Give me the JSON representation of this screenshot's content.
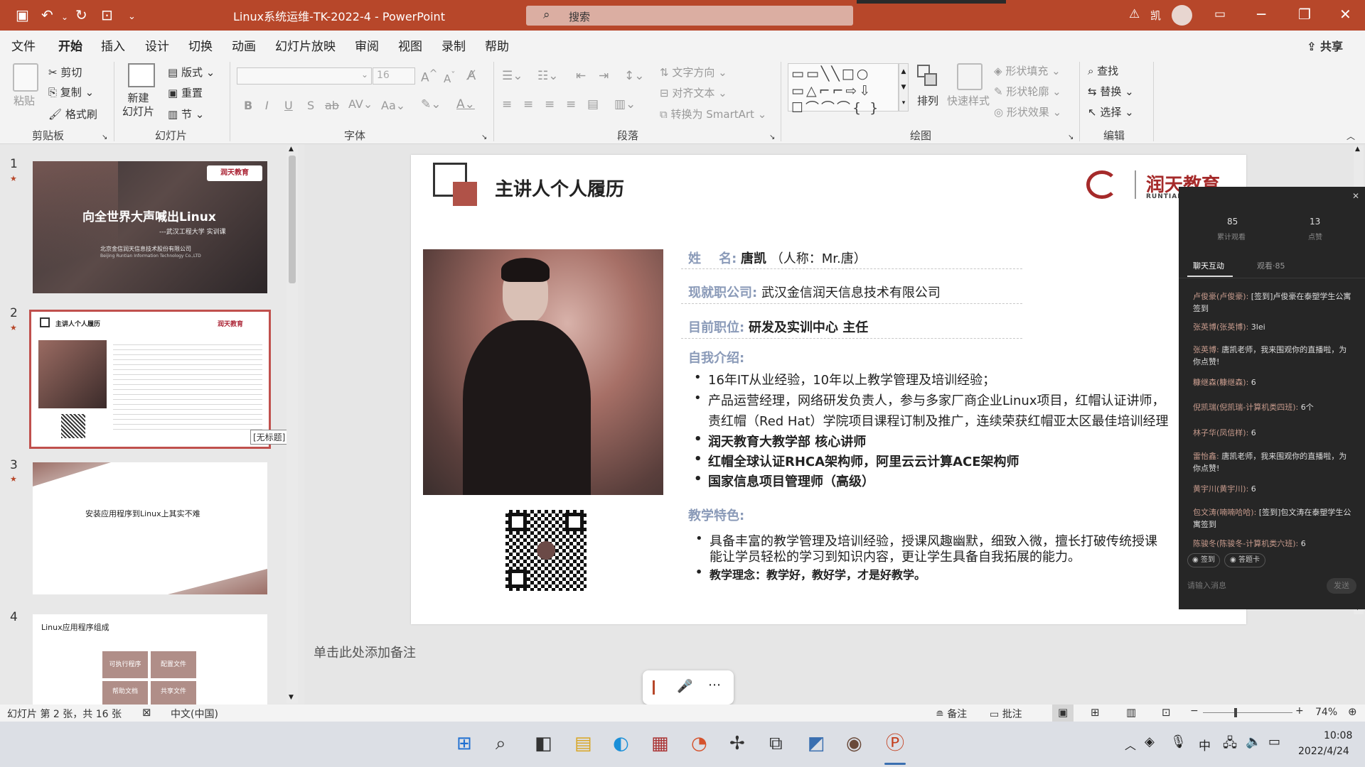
{
  "app": {
    "doc_title": "Linux系统运维-TK-2022-4  -  PowerPoint",
    "search_placeholder": "搜索",
    "user": "凯",
    "share": "共享"
  },
  "menu": [
    "文件",
    "开始",
    "插入",
    "设计",
    "切换",
    "动画",
    "幻灯片放映",
    "审阅",
    "视图",
    "录制",
    "帮助"
  ],
  "ribbon": {
    "paste": "粘贴",
    "cut": "剪切",
    "copy": "复制",
    "format_painter": "格式刷",
    "clipboard": "剪贴板",
    "new_slide": "新建\n幻灯片",
    "layout": "版式",
    "reset": "重置",
    "section": "节",
    "slides": "幻灯片",
    "font_size": "16",
    "font": "字体",
    "text_direction": "文字方向",
    "align_text": "对齐文本",
    "smartart": "转换为 SmartArt",
    "paragraph": "段落",
    "arrange": "排列",
    "quick_styles": "快速样式",
    "shape_fill": "形状填充",
    "shape_outline": "形状轮廓",
    "shape_effects": "形状效果",
    "drawing": "绘图",
    "find": "查找",
    "replace": "替换",
    "select": "选择",
    "editing": "编辑"
  },
  "thumbs": [
    {
      "num": "1",
      "title": "向全世界大声喊出Linux",
      "subtitle": "---武汉工程大学 实训课",
      "company": "北京金信润天信息技术股份有限公司",
      "company_en": "Beijing Runtian Information Technology Co.,LTD",
      "logo": "润天教育"
    },
    {
      "num": "2",
      "title": "主讲人个人履历",
      "logo": "润天教育",
      "tooltip": "[无标题]"
    },
    {
      "num": "3",
      "title": "安装应用程序到Linux上其实不难"
    },
    {
      "num": "4",
      "title": "Linux应用程序组成",
      "boxes": [
        "可执行程序",
        "配置文件",
        "帮助文档",
        "共享文件"
      ]
    }
  ],
  "slide": {
    "title": "主讲人个人履历",
    "logo": "润天教育",
    "logo_en": "RUNTIAN",
    "name_label": "姓    名:",
    "name_value": "唐凯",
    "name_nick": "（人称：Mr.唐）",
    "company_label": "现就职公司:",
    "company_value": "武汉金信润天信息技术有限公司",
    "position_label": "目前职位:",
    "position_value": "研发及实训中心 主任",
    "intro_label": "自我介绍:",
    "intro": [
      "16年IT从业经验，10年以上教学管理及培训经验；",
      "产品运营经理，网络研发负责人，参与多家厂商企业Linux项目，红帽认证讲师，",
      "责红帽（Red Hat）学院项目课程订制及推广，连续荣获红帽亚太区最佳培训经理"
    ],
    "intro_bold": [
      "润天教育大教学部 核心讲师",
      "红帽全球认证RHCA架构师，阿里云云计算ACE架构师",
      "国家信息项目管理师（高级）"
    ],
    "feature_label": "教学特色:",
    "feature_text": "具备丰富的教学管理及培训经验，授课风趣幽默，细致入微，擅长打破传统授课",
    "feature_text2": "能让学员轻松的学习到知识内容，更让学生具备自我拓展的能力。",
    "philosophy": "教学理念：教学好，教好学，才是好教学。"
  },
  "notes_placeholder": "单击此处添加备注",
  "chat": {
    "views": "85",
    "views_label": "累计观看",
    "likes": "13",
    "likes_label": "点赞",
    "tab_chat": "聊天互动",
    "tab_viewers": "观看·85",
    "messages": [
      {
        "user": "卢俊豪(卢俊豪):",
        "text": "[签到]卢俊豪在泰塑学生公寓签到"
      },
      {
        "user": "张英博(张英博):",
        "text": "3lei"
      },
      {
        "user": "张英博:",
        "text": "唐凯老师，我来围观你的直播啦，为你点赞!"
      },
      {
        "user": "糠继森(糠继森):",
        "text": "6"
      },
      {
        "user": "倪凯瑞(倪凯瑞-计算机类四班):",
        "text": "6个"
      },
      {
        "user": "林子华(凤信样):",
        "text": "6"
      },
      {
        "user": "雷怡鑫:",
        "text": "唐凯老师，我来围观你的直播啦，为你点赞!"
      },
      {
        "user": "黄宇川(黄宇川):",
        "text": "6"
      },
      {
        "user": "包文涛(喃喃哈哈):",
        "text": "[签到]包文涛在泰塑学生公寓签到"
      },
      {
        "user": "陈骏冬(陈骏冬-计算机类六班):",
        "text": "6"
      }
    ],
    "checkin": "签到",
    "answer_card": "答题卡",
    "input_placeholder": "请输入消息",
    "send": "发送"
  },
  "statusbar": {
    "slide_info": "幻灯片 第 2 张，共 16 张",
    "lang": "中文(中国)",
    "notes": "备注",
    "comments": "批注",
    "zoom": "74%"
  },
  "taskbar": {
    "time": "10:08",
    "date": "2022/4/24",
    "ime": "中"
  }
}
